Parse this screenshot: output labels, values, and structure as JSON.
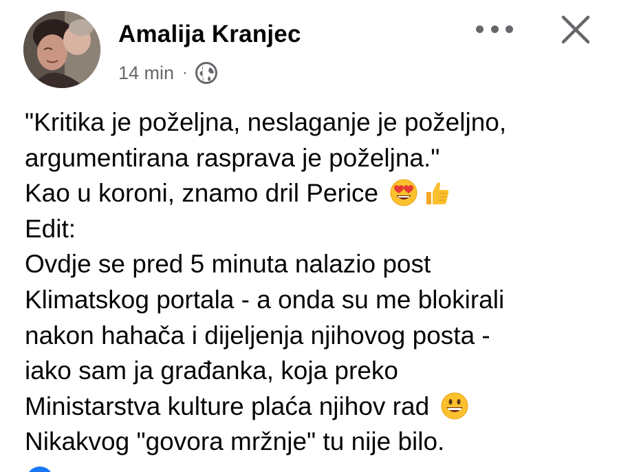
{
  "post": {
    "author": "Amalija Kranjec",
    "timestamp": "14 min",
    "separator": "·",
    "audience_icon": "globe-icon",
    "header_actions": {
      "more_icon": "more-options-icon",
      "close_icon": "close-icon"
    },
    "lines": {
      "l1": "\"Kritika je poželjna, neslaganje je poželjno,",
      "l2": "argumentirana rasprava je poželjna.\"",
      "l3": "Kao u koroni, znamo dril Perice",
      "l4": "Edit:",
      "l5": "Ovdje se pred 5 minuta nalazio post",
      "l6": "Klimatskog portala - a onda su me blokirali",
      "l7": "nakon hahača i dijeljenja njihovog posta -",
      "l8": "iako sam ja građanka, koja preko",
      "l9": "Ministarstva kulture plaća njihov rad",
      "l10": "Nikakvog \"govora mržnje\" tu nije bilo."
    },
    "emojis": [
      "heart-eyes-emoji",
      "thumbs-up-emoji",
      "grinning-face-emoji"
    ]
  },
  "colors": {
    "text": "#050505",
    "secondary_text": "#65676b",
    "brand_blue": "#1877f2",
    "emoji_yellow": "#fbc02d"
  }
}
